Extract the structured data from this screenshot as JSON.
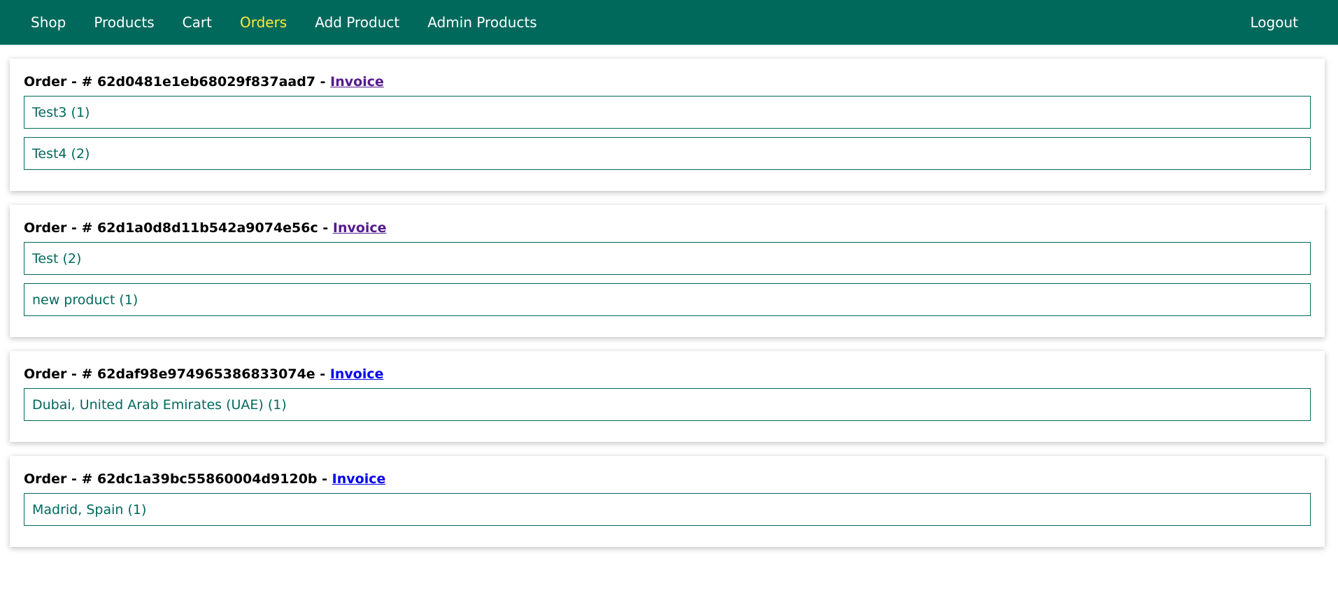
{
  "nav": {
    "left": [
      {
        "label": "Shop",
        "active": false
      },
      {
        "label": "Products",
        "active": false
      },
      {
        "label": "Cart",
        "active": false
      },
      {
        "label": "Orders",
        "active": true
      },
      {
        "label": "Add Product",
        "active": false
      },
      {
        "label": "Admin Products",
        "active": false
      }
    ],
    "logout": "Logout"
  },
  "orders": [
    {
      "prefix": "Order - # ",
      "id": "62d0481e1eb68029f837aad7",
      "sep": " - ",
      "invoice": "Invoice",
      "items": [
        "Test3 (1)",
        "Test4 (2)"
      ]
    },
    {
      "prefix": "Order - # ",
      "id": "62d1a0d8d11b542a9074e56c",
      "sep": " - ",
      "invoice": "Invoice",
      "items": [
        "Test (2)",
        "new product (1)"
      ]
    },
    {
      "prefix": "Order - # ",
      "id": "62daf98e974965386833074e",
      "sep": " - ",
      "invoice": "Invoice",
      "items": [
        "Dubai, United Arab Emirates (UAE) (1)"
      ]
    },
    {
      "prefix": "Order - # ",
      "id": "62dc1a39bc55860004d9120b",
      "sep": " - ",
      "invoice": "Invoice",
      "items": [
        "Madrid, Spain (1)"
      ]
    }
  ],
  "colors": {
    "nav_bg": "#00695c",
    "active": "#ffeb3b",
    "item_border": "#00695c",
    "link_visited": "#551a8b",
    "link_unvisited": "#0000ee"
  }
}
